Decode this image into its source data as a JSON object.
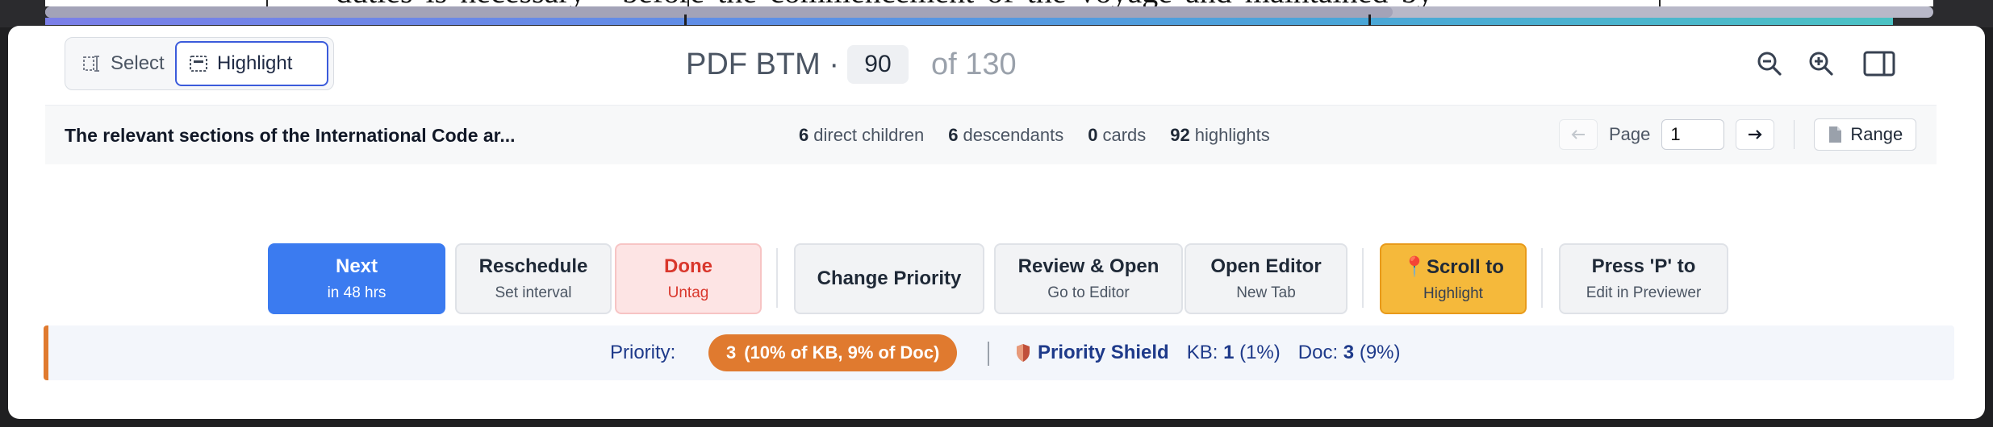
{
  "document_view": {
    "visible_text": "duties is necessary   ·   before the commencement of the voyage and maintained by"
  },
  "toolbar": {
    "select_label": "Select",
    "highlight_label": "Highlight",
    "doc_name": "PDF BTM ·",
    "current_page": "90",
    "of_pages": "of 130"
  },
  "info_bar": {
    "title": "The relevant sections of the International Code ar...",
    "stats": [
      {
        "count": "6",
        "label": "direct children"
      },
      {
        "count": "6",
        "label": "descendants"
      },
      {
        "count": "0",
        "label": "cards"
      },
      {
        "count": "92",
        "label": "highlights"
      }
    ],
    "page_label": "Page",
    "page_value": "1",
    "range_label": "Range"
  },
  "actions": [
    {
      "title": "Next",
      "sub": "in 48 hrs"
    },
    {
      "title": "Reschedule",
      "sub": "Set interval"
    },
    {
      "title": "Done",
      "sub": "Untag"
    },
    {
      "title": "Change Priority",
      "sub": ""
    },
    {
      "title": "Review & Open",
      "sub": "Go to Editor"
    },
    {
      "title": "Open Editor",
      "sub": "New Tab"
    },
    {
      "title": "Scroll to",
      "sub": "Highlight"
    },
    {
      "title": "Press 'P' to",
      "sub": "Edit in Previewer"
    }
  ],
  "priority": {
    "label": "Priority:",
    "value": "3",
    "detail": "(10% of KB, 9% of Doc)",
    "shield_label": "Priority Shield",
    "kb_label": "KB:",
    "kb_value": "1",
    "kb_pct": "(1%)",
    "doc_label": "Doc:",
    "doc_value": "3",
    "doc_pct": "(9%)"
  },
  "colors": {
    "accent_blue": "#3b7bf0",
    "done_red": "#d9372c",
    "scroll_orange": "#f5b93b",
    "priority_orange": "#e07a2f"
  }
}
